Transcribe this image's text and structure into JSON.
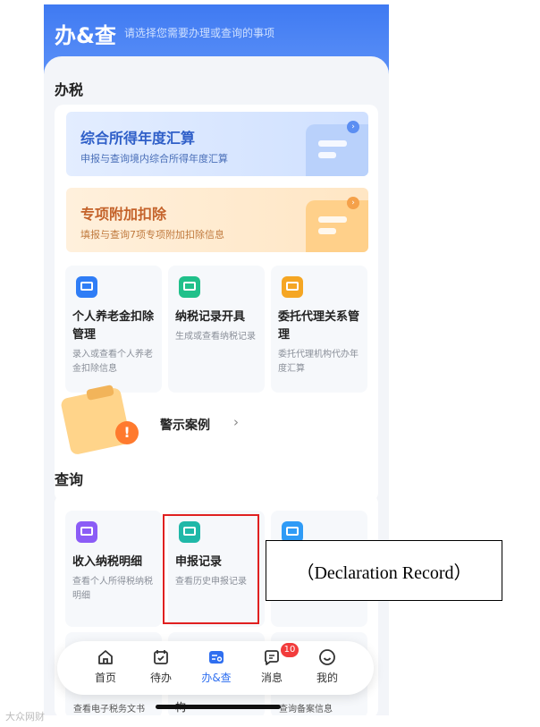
{
  "header": {
    "title": "办&查",
    "subtitle": "请选择您需要办理或查询的事项"
  },
  "tax_section": {
    "title": "办税",
    "banners": [
      {
        "title": "综合所得年度汇算",
        "subtitle": "申报与查询境内综合所得年度汇算"
      },
      {
        "title": "专项附加扣除",
        "subtitle": "填报与查询7项专项附加扣除信息"
      }
    ],
    "tiles": [
      {
        "name": "个人养老金扣除管理",
        "desc": "录入或查看个人养老金扣除信息",
        "icon_color": "#2f7df6"
      },
      {
        "name": "纳税记录开具",
        "desc": "生成或查看纳税记录",
        "icon_color": "#20c08a"
      },
      {
        "name": "委托代理关系管理",
        "desc": "委托代理机构代办年度汇算",
        "icon_color": "#f5a623"
      }
    ],
    "warning_label": "警示案例"
  },
  "query_section": {
    "title": "查询",
    "tiles": [
      {
        "name": "收入纳税明细",
        "desc": "查看个人所得税纳税明细",
        "icon_color": "#8b5cf6"
      },
      {
        "name": "申报记录",
        "desc": "查看历史申报记录",
        "icon_color": "#20b8a8"
      }
    ],
    "bottom_texts": [
      "查看电子税务文书",
      "构",
      "查询备案信息"
    ]
  },
  "callout": "（Declaration Record）",
  "tabbar": {
    "tabs": [
      {
        "label": "首页",
        "icon": "home-icon"
      },
      {
        "label": "待办",
        "icon": "calendar-check-icon"
      },
      {
        "label": "办&查",
        "icon": "task-search-icon",
        "active": true
      },
      {
        "label": "消息",
        "icon": "message-icon"
      },
      {
        "label": "我的",
        "icon": "smile-icon"
      }
    ],
    "message_badge": "10"
  },
  "watermark": "大众网财",
  "colors": {
    "accent": "#2f6ff0",
    "highlight": "#e02020"
  }
}
